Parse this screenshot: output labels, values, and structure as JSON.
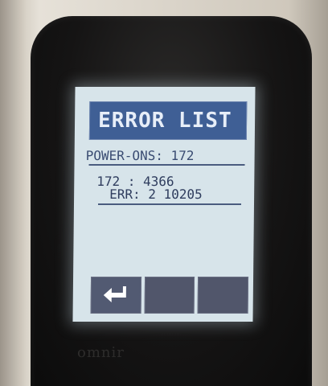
{
  "screen": {
    "title": "ERROR LIST",
    "power_ons": "POWER-ONS: 172",
    "entries": [
      {
        "line1": "172 : 4366",
        "line2": "ERR: 2 10205"
      }
    ]
  },
  "softkeys": {
    "enter_icon": "return-arrow-icon",
    "key2_label": "",
    "key3_label": ""
  },
  "device": {
    "brand": "omnir"
  },
  "colors": {
    "title_bar": "#3f5f95",
    "screen_bg": "#d7e4ea",
    "text": "#3a4c72",
    "softkey": "#51566b"
  }
}
